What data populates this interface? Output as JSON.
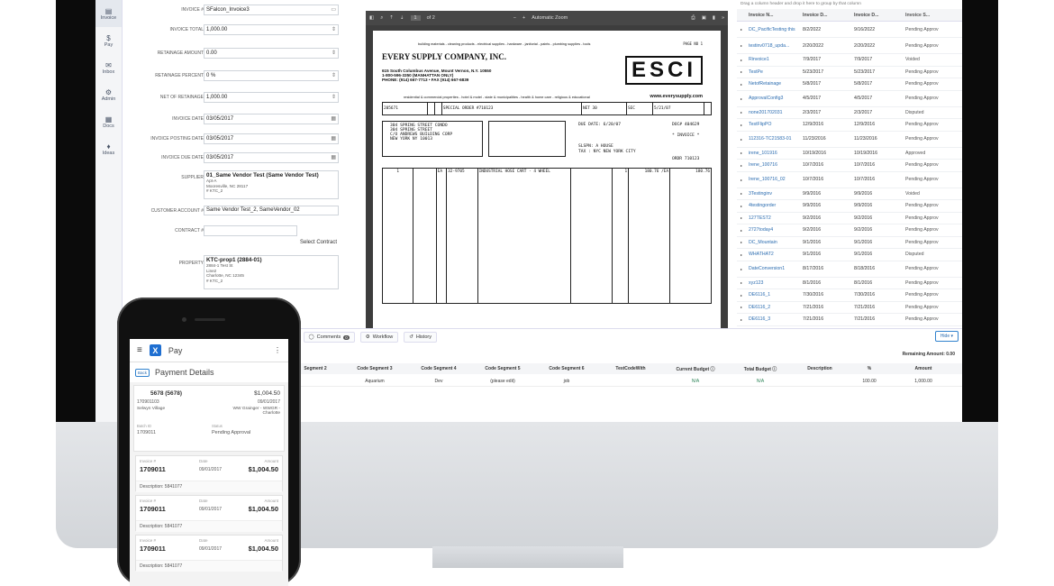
{
  "nav": {
    "items": [
      {
        "label": "Invoice",
        "icon": "invoice-icon"
      },
      {
        "label": "Pay",
        "icon": "dollar-icon"
      },
      {
        "label": "Inbox",
        "icon": "inbox-icon"
      },
      {
        "label": "Admin",
        "icon": "gear-icon"
      },
      {
        "label": "Docs",
        "icon": "docs-icon"
      },
      {
        "label": "Ideas",
        "icon": "bulb-icon"
      }
    ]
  },
  "form": {
    "invoice_no_label": "INVOICE #",
    "invoice_no": "SFalcon_Invoice3",
    "invoice_total_label": "INVOICE TOTAL",
    "invoice_total": "1,000.00",
    "retainage_amount_label": "RETAINAGE AMOUNT",
    "retainage_amount": "0.00",
    "retainage_percent_label": "RETAINAGE PERCENT",
    "retainage_percent": "0 %",
    "net_of_retainage_label": "NET OF RETAINAGE",
    "net_of_retainage": "1,000.00",
    "invoice_date_label": "INVOICE DATE",
    "invoice_date": "03/05/2017",
    "posting_date_label": "INVOICE POSTING DATE",
    "posting_date": "03/05/2017",
    "due_date_label": "INVOICE DUE DATE",
    "due_date": "03/05/2017",
    "supplier_label": "SUPPLIER",
    "supplier_name": "01_Same Vendor Test (Same Vendor Test)",
    "supplier_addr1": "Apt-A",
    "supplier_addr2": "Mooresville, NC 28117",
    "supplier_addr3": "# KTC_2",
    "customer_account_label": "CUSTOMER ACCOUNT #",
    "customer_account": "Same Vendor Test_2, SameVendor_02",
    "contract_label": "CONTRACT #",
    "select_contract": "Select Contract",
    "property_label": "PROPERTY",
    "property_name": "KTC-prop1 (2884-01)",
    "property_addr1": "2884-1 Test St",
    "property_addr2": "Line2",
    "property_addr3": "Charlotte, NC 12345",
    "property_addr4": "# KTC_2"
  },
  "pdf": {
    "page": "1",
    "of": "of 2",
    "zoom": "Automatic Zoom",
    "tagline": "building materials - cleaning products - electrical supplies - hardware - janitorial - paints - plumbing supplies - tools",
    "page_label": "PAGE NO  1",
    "company": "EVERY SUPPLY COMPANY, INC.",
    "address": "615 South Columbus Avenue, Mount Vernon, N.Y. 10550",
    "phone1": "1-800-596-3350 (MANHATTAN ONLY)",
    "phone2": "PHONE: (914) 667-7713 • FAX (914) 667-6839",
    "logo": "ESCI",
    "web": "www.everysupply.com",
    "sub": "residential & commercial properties - hotel & motel - state & municipalities - health & home care - religious & educational",
    "cust_no": "205671",
    "ref": "SPECIAL ORDER #710123",
    "terms": "NET 30",
    "clerk": "SEC",
    "date": "5/21/07",
    "bill1": "304 SPRING STREET CONDO",
    "bill2": "304 SPRING STREET",
    "bill3": "C/O ANDREWS BUILDING CORP",
    "bill4": "NEW YORK      NY 10013",
    "due_date": "DUE DATE:  6/20/07",
    "doc": "DOC#  404629",
    "invoice_hash": "* INVOICE *",
    "slspn": "SLSPN:   A  HOUSE",
    "tax": "TAX  :   NYC NEW YORK CITY",
    "order": "ORDR  710123",
    "line_qty": "1",
    "line_um": "EA",
    "line_sku": "32-9705",
    "line_desc": "INDUSTRIAL HOSE CART - 4 WHEEL",
    "line_units": "1",
    "line_price": "180.76 /EA",
    "line_ext": "180.76"
  },
  "grid": {
    "hint": "Drag a column header and drop it here to group by that column",
    "headers": [
      "Invoice N...",
      "Invoice D...",
      "Invoice D...",
      "Invoice S..."
    ],
    "rows": [
      [
        "DC_PacificTesting this",
        "8/2/2022",
        "9/16/2022",
        "Pending Approv"
      ],
      [
        "testinv0718_upda...",
        "2/20/2022",
        "2/20/2022",
        "Pending Approv"
      ],
      [
        "Rinvoice1",
        "7/9/2017",
        "7/9/2017",
        "Voided"
      ],
      [
        "TestPe",
        "5/23/2017",
        "5/23/2017",
        "Pending Approv"
      ],
      [
        "NetofRetainage",
        "5/8/2017",
        "5/8/2017",
        "Pending Approv"
      ],
      [
        "ApprovalConfig3",
        "4/5/2017",
        "4/5/2017",
        "Pending Approv"
      ],
      [
        "none201702031",
        "2/3/2017",
        "2/3/2017",
        "Disputed"
      ],
      [
        "TestFlipPO",
        "12/9/2016",
        "12/9/2016",
        "Pending Approv"
      ],
      [
        "112316-TC21583-01",
        "11/23/2016",
        "11/23/2016",
        "Pending Approv"
      ],
      [
        "irene_101916",
        "10/19/2016",
        "10/19/2016",
        "Approved"
      ],
      [
        "Irene_100716",
        "10/7/2016",
        "10/7/2016",
        "Pending Approv"
      ],
      [
        "Irene_100716_02",
        "10/7/2016",
        "10/7/2016",
        "Pending Approv"
      ],
      [
        "3Testinginv",
        "9/9/2016",
        "9/9/2016",
        "Voided"
      ],
      [
        "4testingorder",
        "9/9/2016",
        "9/9/2016",
        "Pending Approv"
      ],
      [
        "127TEST2",
        "9/2/2016",
        "9/2/2016",
        "Pending Approv"
      ],
      [
        "2727today4",
        "9/2/2016",
        "9/2/2016",
        "Pending Approv"
      ],
      [
        "DC_Mountain",
        "9/1/2016",
        "9/1/2016",
        "Pending Approv"
      ],
      [
        "WHATHAT2",
        "9/1/2016",
        "9/1/2016",
        "Disputed"
      ],
      [
        "DateConversion1",
        "8/17/2016",
        "8/18/2016",
        "Pending Approv"
      ],
      [
        "xyz123",
        "8/1/2016",
        "8/1/2016",
        "Pending Approv"
      ],
      [
        "DE6116_1",
        "7/30/2016",
        "7/30/2016",
        "Pending Approv"
      ],
      [
        "DE6116_2",
        "7/21/2016",
        "7/21/2016",
        "Pending Approv"
      ],
      [
        "DE6116_3",
        "7/21/2016",
        "7/21/2016",
        "Pending Approv"
      ]
    ]
  },
  "bottom": {
    "comments": "Comments",
    "comments_count": "0",
    "workflow": "Workflow",
    "history": "History",
    "attach_count": "0",
    "hide": "Hide ▾",
    "remaining": "Remaining Amount: 0.00",
    "headers": [
      "Segment 2",
      "Code Segment 3",
      "Code Segment 4",
      "Code Segment 5",
      "Code Segment 6",
      "TestCodeWith",
      "Current Budget ⓘ",
      "Total Budget ⓘ",
      "Description",
      "%",
      "Amount"
    ],
    "row": [
      "",
      "Aquarium",
      "Dev",
      "(please edit)",
      "job",
      "",
      "N/A",
      "N/A",
      "",
      "100.00",
      "1,000.00"
    ]
  },
  "phone": {
    "app": "Pay",
    "title": "Payment Details",
    "back": "Back",
    "vendor": "5678 (5678)",
    "amount": "$1,004.50",
    "id": "170901103",
    "date": "09/01/2017",
    "location": "Selwyn Village",
    "location2": "WW Grainger - WWGR - Charlotte",
    "batch_label": "Batch ID",
    "batch": "1709011",
    "status_label": "Status",
    "status": "Pending Approval",
    "invoices": [
      {
        "label": "Invoice #",
        "no": "1709011",
        "date_label": "Date",
        "date": "09/01/2017",
        "amount_label": "Amount",
        "amount": "$1,004.50",
        "desc": "Description:  5841077"
      },
      {
        "label": "Invoice #",
        "no": "1709011",
        "date_label": "Date",
        "date": "09/01/2017",
        "amount_label": "Amount",
        "amount": "$1,004.50",
        "desc": "Description:  5841077"
      },
      {
        "label": "Invoice #",
        "no": "1709011",
        "date_label": "Date",
        "date": "09/01/2017",
        "amount_label": "Amount",
        "amount": "$1,004.50",
        "desc": "Description:  5841077"
      }
    ]
  }
}
